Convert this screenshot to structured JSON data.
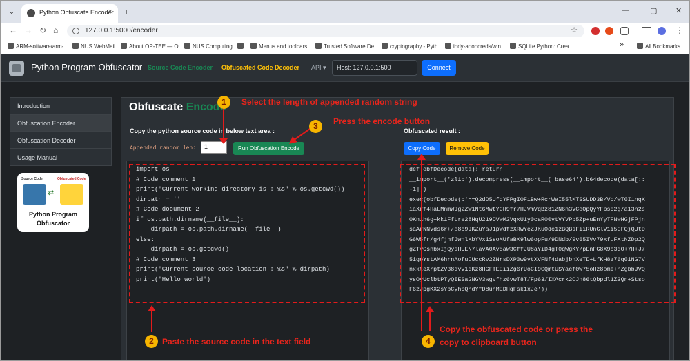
{
  "browser": {
    "tab_title": "Python Obfuscate Encoder",
    "tab_close": "×",
    "new_tab": "+",
    "url": "127.0.0.1:5000/encoder",
    "window_controls": [
      "—",
      "▢",
      "✕"
    ],
    "bookmarks": [
      "ARM-software/arm-...",
      "NUS WebMail",
      "About OP-TEE — O...",
      "NUS Computing",
      "Menus and toolbars...",
      "Trusted Software De...",
      "cryptography - Pyth...",
      "indy-anoncreds/win...",
      "SQLite Python: Crea..."
    ],
    "bookmarks_more": "»",
    "all_bookmarks": "All Bookmarks"
  },
  "app": {
    "brand": "Python Program Obfuscator",
    "nav_encoder": "Source Code Encoder",
    "nav_decoder": "Obfuscated Code Decoder",
    "nav_api": "API ▾",
    "host": "Host: 127.0.0.1:500",
    "connect": "Connect",
    "colors": {
      "encoder_link": "#198754",
      "decoder_link": "#ffc107",
      "connect": "#0d6efd"
    }
  },
  "sidebar": {
    "items": [
      "Introduction",
      "Obfuscation Encoder",
      "Obfuscation Decoder",
      "Usage Manual"
    ],
    "logo_left": "Source Code",
    "logo_right": "Obfuscated Code",
    "logo_caption_1": "Python Program",
    "logo_caption_2": "Obfuscator"
  },
  "main": {
    "title_a": "Obfuscate ",
    "title_b": "Encode",
    "copy_label": "Copy the python source code in below text area :",
    "random_len_label": "Appended random len:",
    "random_len_value": "1",
    "run_button": "Run Obfuscation Encode",
    "result_label": "Obfuscated result :",
    "copy_button": "Copy Code",
    "remove_button": "Remove Code",
    "source_code": "import os\n# Code comment 1\nprint(\"Current working directory is : %s\" % os.getcwd())\ndirpath = ''\n# Code document 2\nif os.path.dirname(__file__):\n    dirpath = os.path.dirname(__file__)\nelse:\n    dirpath = os.getcwd()\n# Code comment 3\nprint(\"Current source code location : %s\" % dirpath)\nprint(\"Hello world\")",
    "result_code": "def obfDecode(data): return\n__import__('zlib').decompress(__import__('base64').b64decode(data[::\n-1]))\nexec(obfDecode(b'==Q2dD5UfdYFPgIOFiBw+RcrWaI55lKTSSUDD3B/Vc/wT0I1nqK\niaXrf4HaLMnmWJg2ZW1Nt6MwtYCH9fr7HJVmVqBz81ZN6n3VCoOpQyYFps02g/a13n2s\nOKn1h6g+kk1FfLre28HqU219DVwM2VqxU1y0caR00vtVYVPb5Zp+uEnYyTFNwHGjFPjn\nsaArNNvds6r+/o8c9JKZuYaJ1pWdfzXRwYeZJKuOdc1zBQBsFiiRUnGlV1i5CFQjQUtD\nG6W5fr/g4fjhfJwnlKbYVxiSsoMUfaBX9lw6opFu/9DNdb/9v65IVv79xfuFXtNZDp2Q\ngZTvGsnbxIjQysHUEN7lavA0Av5aW3CffJU8aYiD4gT0qWgKY/pEnFG8X9c3dO+7H+J7\n5igeYstAM6hrnAofuCUccRv2ZNrsDXP0w9vtXVFNf4dabjbnXeTD+LfKH8z76q0iNG7V\nnxkteXrptZV38dvv1dKz8HGFTEEiiZg6rUoCI9CQmtUSYacf0W75oHz8ome+nZgbbJVQ\nysOyUclbtPTyQIESaGNGV3wgvfhz6vwT8T/Fp63/IXAcrk2CJn86tQbpdl1Z3Qn+Stso\nF6zJpgKX2sYbCyh0QhdYfD8uhMEDHqFsk1xJe'))"
  },
  "annotations": {
    "step1_num": "1",
    "step1_text": "Select the length of appended random string",
    "step2_num": "2",
    "step2_text": "Paste the source code in the text field",
    "step3_num": "3",
    "step3_text": "Press the encode button",
    "step4_num": "4",
    "step4_text_1": "Copy the obfuscated code or press the",
    "step4_text_2": "copy to clipboard button",
    "color": "#e21b1b",
    "badge_color": "#f7b500"
  }
}
